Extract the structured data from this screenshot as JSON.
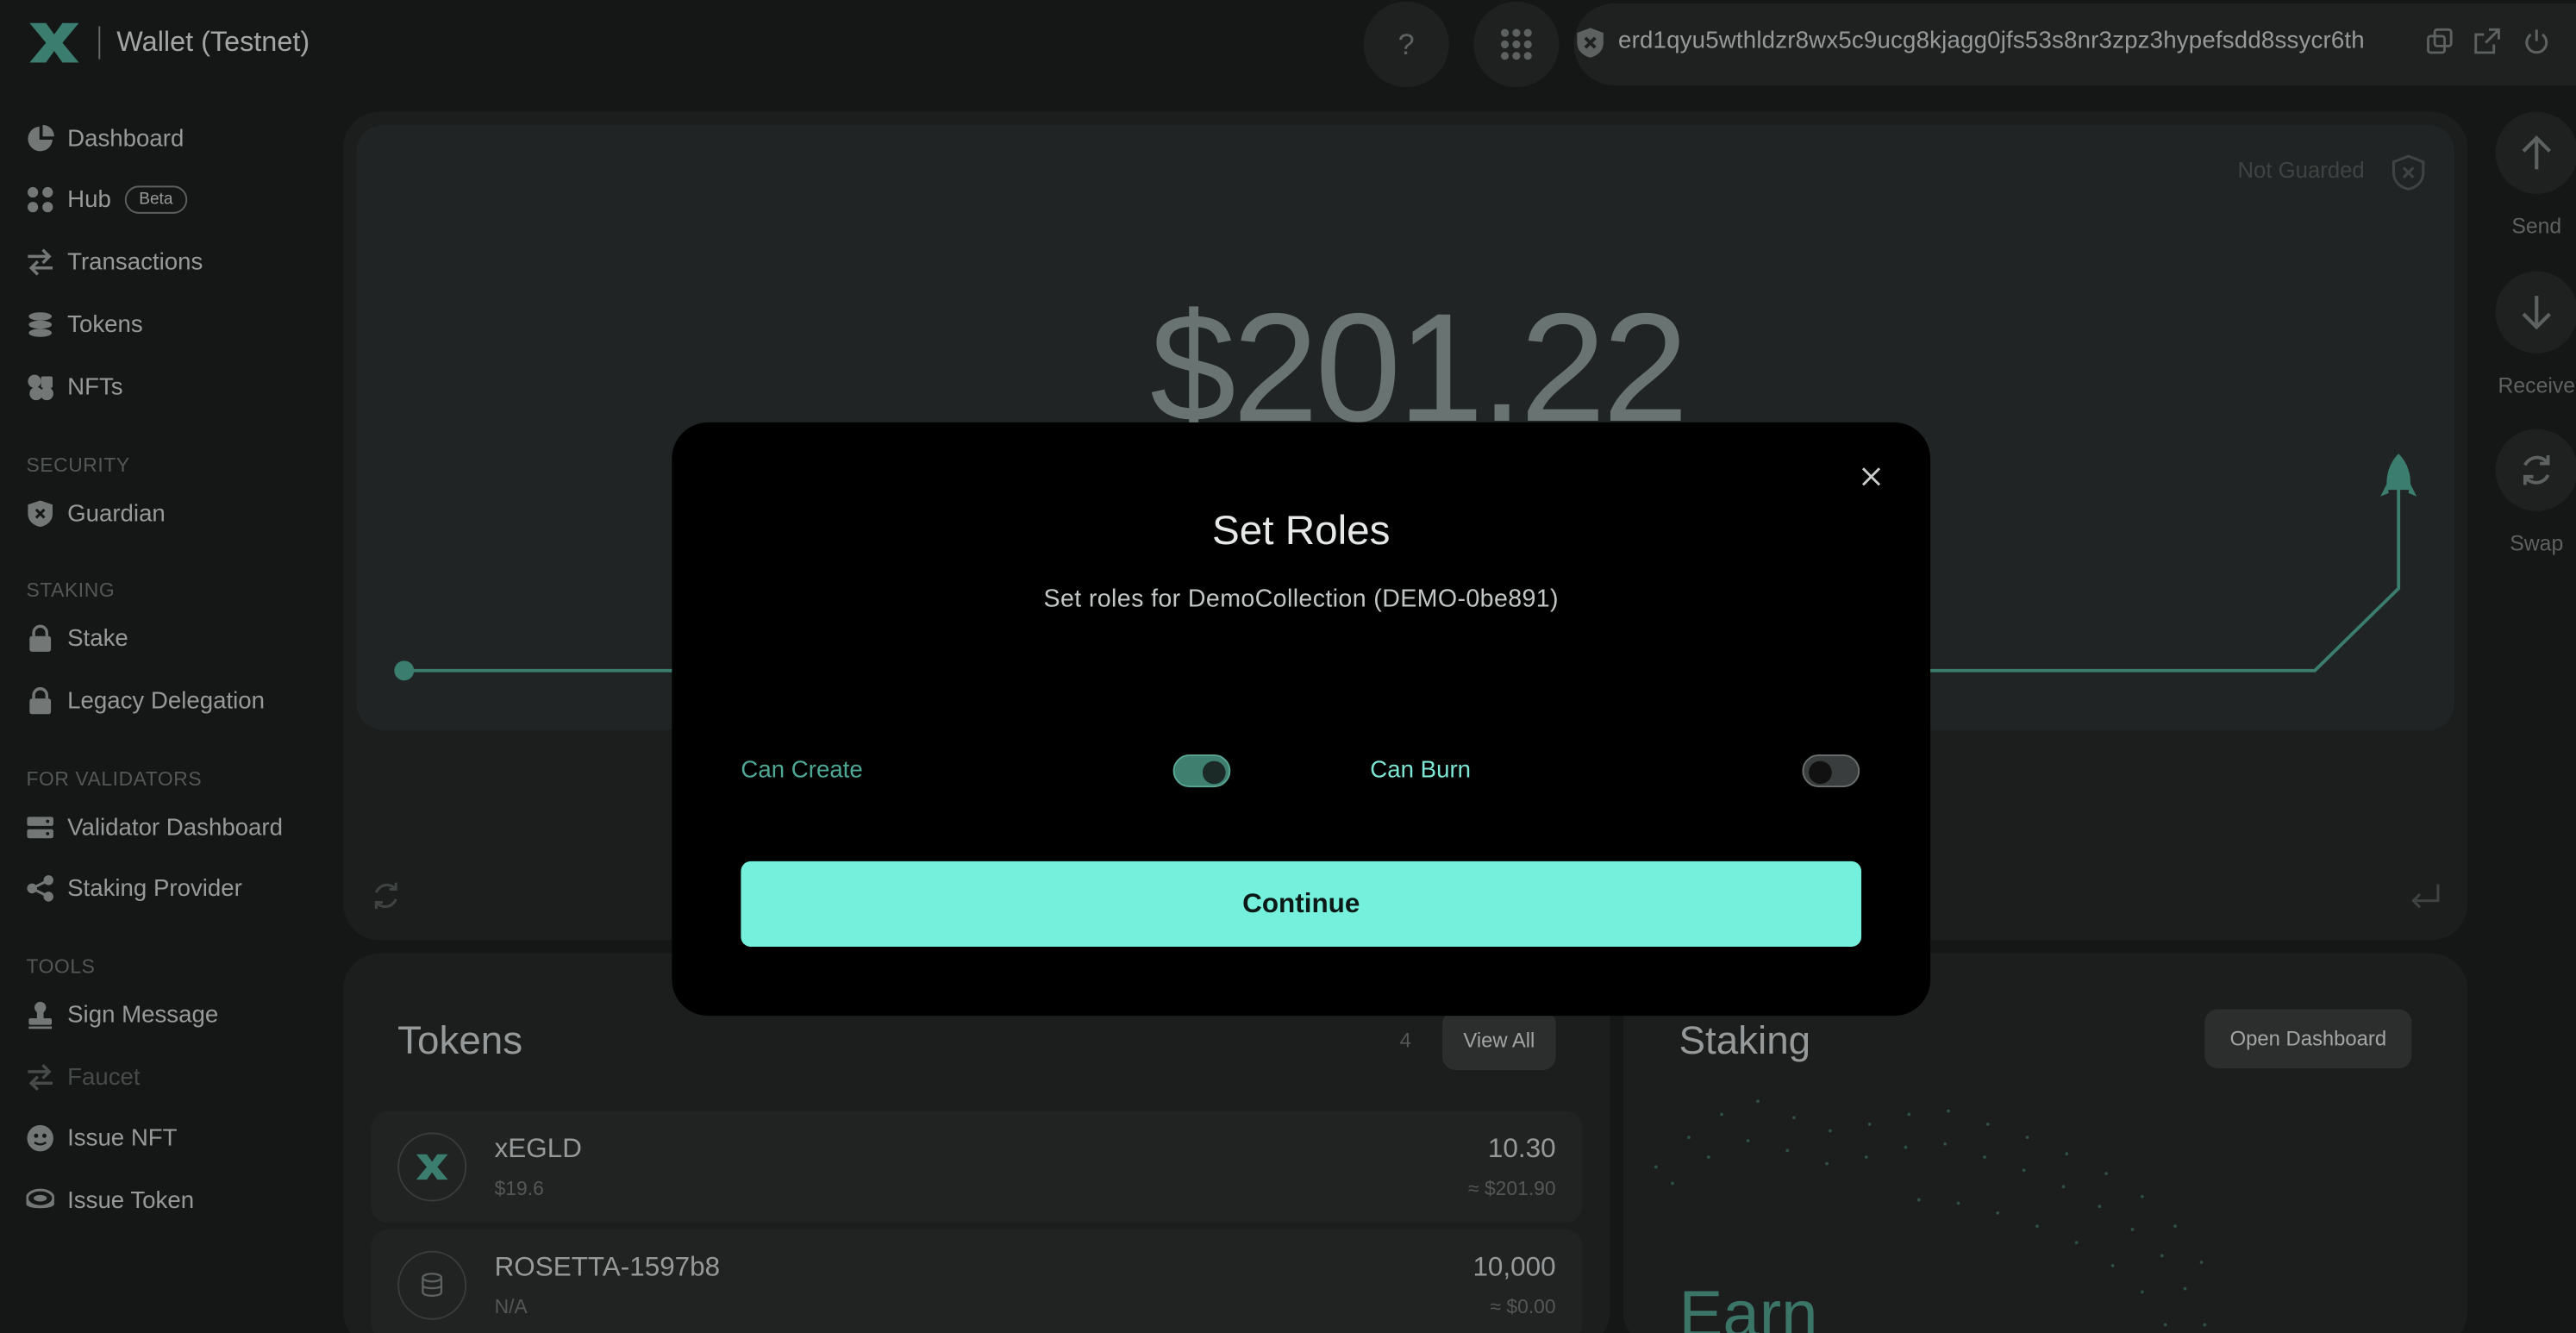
{
  "app": {
    "title": "Wallet (Testnet)",
    "address": "erd1qyu5wthldzr8wx5c9ucg8kjagg0jfs53s8nr3zpz3hypefsdd8ssycr6th"
  },
  "header": {
    "help_label": "?",
    "accent_color": "#75f0dc"
  },
  "sidebar": {
    "items": [
      {
        "label": "Dashboard"
      },
      {
        "label": "Hub",
        "badge": "Beta"
      },
      {
        "label": "Transactions"
      },
      {
        "label": "Tokens"
      },
      {
        "label": "NFTs"
      }
    ],
    "sections": [
      {
        "title": "SECURITY",
        "items": [
          {
            "label": "Guardian"
          }
        ]
      },
      {
        "title": "STAKING",
        "items": [
          {
            "label": "Stake"
          },
          {
            "label": "Legacy Delegation"
          }
        ]
      },
      {
        "title": "FOR VALIDATORS",
        "items": [
          {
            "label": "Validator Dashboard"
          },
          {
            "label": "Staking Provider"
          }
        ]
      },
      {
        "title": "TOOLS",
        "items": [
          {
            "label": "Sign Message"
          },
          {
            "label": "Faucet",
            "disabled": true
          },
          {
            "label": "Issue NFT"
          },
          {
            "label": "Issue Token"
          }
        ]
      }
    ]
  },
  "balance_card": {
    "guard_status": "Not Guarded",
    "balance": "$201.22"
  },
  "actions": [
    {
      "label": "Send",
      "icon": "arrow-up-icon"
    },
    {
      "label": "Receive",
      "icon": "arrow-down-icon"
    },
    {
      "label": "Swap",
      "icon": "swap-icon"
    }
  ],
  "tokens_card": {
    "title": "Tokens",
    "count": "4",
    "view_all_label": "View All",
    "rows": [
      {
        "name": "xEGLD",
        "price": "$19.6",
        "amount": "10.30",
        "usd": "≈ $201.90"
      },
      {
        "name": "ROSETTA-1597b8",
        "price": "N/A",
        "amount": "10,000",
        "usd": "≈ $0.00"
      }
    ]
  },
  "staking_card": {
    "title": "Staking",
    "open_dashboard_label": "Open Dashboard",
    "earn_label": "Earn"
  },
  "modal": {
    "title": "Set Roles",
    "subtitle": "Set roles for DemoCollection (DEMO-0be891)",
    "roles": [
      {
        "label": "Can Create",
        "enabled": true
      },
      {
        "label": "Can Burn",
        "enabled": false
      }
    ],
    "continue_label": "Continue"
  }
}
